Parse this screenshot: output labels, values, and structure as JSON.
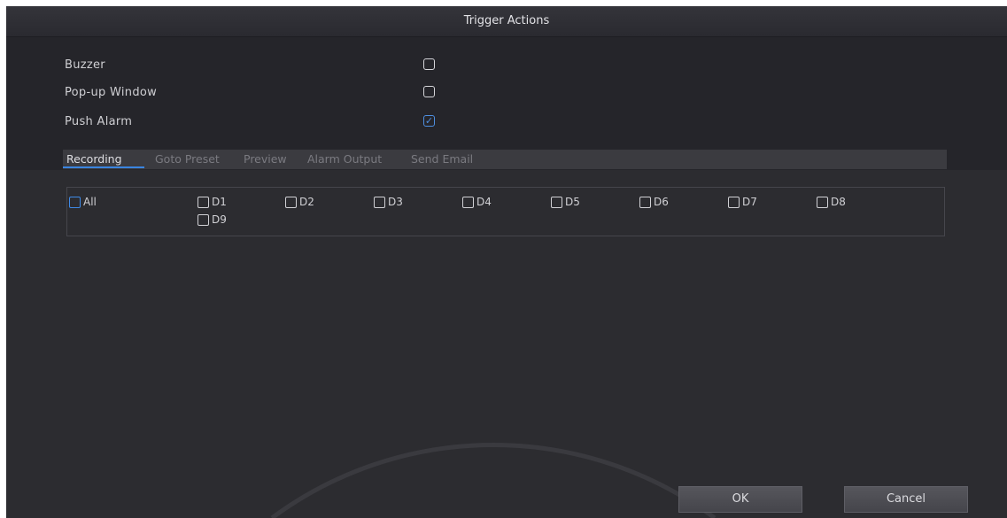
{
  "dialog": {
    "title": "Trigger Actions"
  },
  "options": [
    {
      "label": "Buzzer",
      "checked": false
    },
    {
      "label": "Pop-up Window",
      "checked": false
    },
    {
      "label": "Push Alarm",
      "checked": true
    }
  ],
  "tabs": [
    {
      "label": "Recording",
      "active": true
    },
    {
      "label": "Goto Preset",
      "active": false
    },
    {
      "label": "Preview",
      "active": false
    },
    {
      "label": "Alarm Output",
      "active": false
    },
    {
      "label": "Send Email",
      "active": false
    }
  ],
  "channels": [
    {
      "label": "All",
      "checked": false
    },
    {
      "label": "D1",
      "checked": false
    },
    {
      "label": "D2",
      "checked": false
    },
    {
      "label": "D3",
      "checked": false
    },
    {
      "label": "D4",
      "checked": false
    },
    {
      "label": "D5",
      "checked": false
    },
    {
      "label": "D6",
      "checked": false
    },
    {
      "label": "D7",
      "checked": false
    },
    {
      "label": "D8",
      "checked": false
    },
    {
      "label": "D9",
      "checked": false
    }
  ],
  "buttons": {
    "ok": "OK",
    "cancel": "Cancel"
  },
  "colors": {
    "accent": "#3a85e0",
    "background": "#2c2c30",
    "text": "#d0d0d4"
  }
}
